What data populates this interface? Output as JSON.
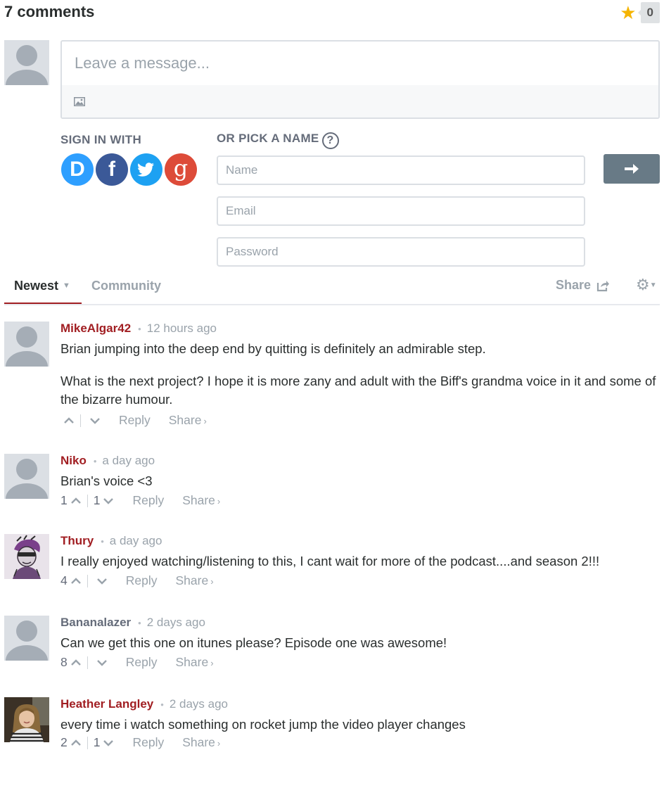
{
  "header": {
    "comment_count_label": "7 comments",
    "recommend_count": "0",
    "star_color": "#f5b400"
  },
  "composer": {
    "placeholder": "Leave a message..."
  },
  "login": {
    "sign_in_label": "SIGN IN WITH",
    "pick_name_label": "OR PICK A NAME",
    "help_glyph": "?",
    "providers": [
      {
        "name": "disqus",
        "glyph": "D",
        "color": "#2e9fff"
      },
      {
        "name": "facebook",
        "glyph": "f",
        "color": "#3b5998"
      },
      {
        "name": "twitter",
        "glyph": "twitter-bird",
        "color": "#1da1f2"
      },
      {
        "name": "google",
        "glyph": "g",
        "color": "#dd4b39"
      }
    ],
    "name_placeholder": "Name",
    "email_placeholder": "Email",
    "password_placeholder": "Password",
    "submit_icon": "arrow-right-icon"
  },
  "nav": {
    "tabs": [
      {
        "label": "Newest",
        "active": true
      },
      {
        "label": "Community",
        "active": false
      }
    ],
    "share_label": "Share",
    "accent": "#a11e22"
  },
  "comments": [
    {
      "author": "MikeAlgar42",
      "time": "12 hours ago",
      "paragraphs": [
        "Brian jumping into the deep end by quitting is definitely an admirable step.",
        "What is the next project? I hope it is more zany and adult with the Biff's grandma voice in it and some of the bizarre humour."
      ],
      "upvotes": "",
      "downvotes": "",
      "reply_label": "Reply",
      "share_label": "Share"
    },
    {
      "author": "Niko",
      "time": "a day ago",
      "paragraphs": [
        "Brian's voice <3"
      ],
      "upvotes": "1",
      "downvotes": "1",
      "reply_label": "Reply",
      "share_label": "Share"
    },
    {
      "author": "Thury",
      "time": "a day ago",
      "paragraphs": [
        "I really enjoyed watching/listening to this, I cant wait for more of the podcast....and season 2!!!"
      ],
      "upvotes": "4",
      "downvotes": "",
      "reply_label": "Reply",
      "share_label": "Share"
    },
    {
      "author": "Bananalazer",
      "time": "2 days ago",
      "paragraphs": [
        "Can we get this one on itunes please? Episode one was awesome!"
      ],
      "upvotes": "8",
      "downvotes": "",
      "reply_label": "Reply",
      "share_label": "Share"
    },
    {
      "author": "Heather Langley",
      "time": "2 days ago",
      "paragraphs": [
        "every time i watch something on rocket jump the video player changes"
      ],
      "upvotes": "2",
      "downvotes": "1",
      "reply_label": "Reply",
      "share_label": "Share"
    }
  ]
}
